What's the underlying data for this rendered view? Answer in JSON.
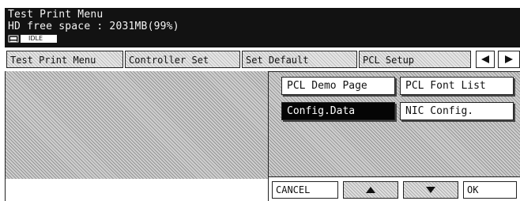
{
  "header": {
    "title": "Test Print Menu",
    "hd_free_space": "HD free space : 2031MB(99%)",
    "status": "IDLE"
  },
  "tabs": [
    {
      "label": "Test Print Menu"
    },
    {
      "label": "Controller Set"
    },
    {
      "label": "Set Default"
    },
    {
      "label": "PCL Setup"
    }
  ],
  "options": [
    {
      "label": "PCL Demo Page",
      "selected": false
    },
    {
      "label": "PCL Font List",
      "selected": false
    },
    {
      "label": "Config.Data",
      "selected": true
    },
    {
      "label": "NIC Config.",
      "selected": false
    }
  ],
  "footer": {
    "cancel_label": "CANCEL",
    "ok_label": "OK"
  },
  "icons": {
    "printer": "printer-icon",
    "prev": "left-arrow-icon",
    "next": "right-arrow-icon",
    "up": "up-arrow-icon",
    "down": "down-arrow-icon"
  }
}
